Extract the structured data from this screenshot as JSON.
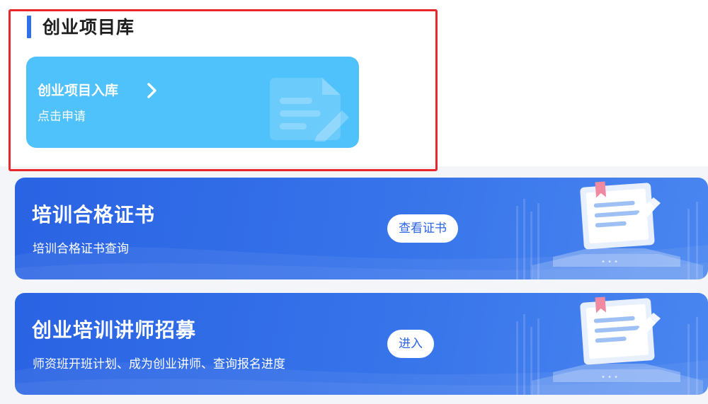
{
  "section": {
    "title": "创业项目库"
  },
  "entry_card": {
    "title": "创业项目入库",
    "subtitle": "点击申请"
  },
  "banners": [
    {
      "title": "培训合格证书",
      "subtitle": "培训合格证书查询",
      "button_label": "查看证书"
    },
    {
      "title": "创业培训讲师招募",
      "subtitle": "师资班开班计划、成为创业讲师、查询报名进度",
      "button_label": "进入"
    }
  ],
  "icons": [
    "chevron-right-icon",
    "document-edit-icon",
    "certificate-illustration"
  ],
  "colors": {
    "highlight": "#e8262b",
    "accent": "#2f6fe8",
    "entry_card_bg": "#4fc1fb",
    "banner_bg": "#3270e8"
  }
}
